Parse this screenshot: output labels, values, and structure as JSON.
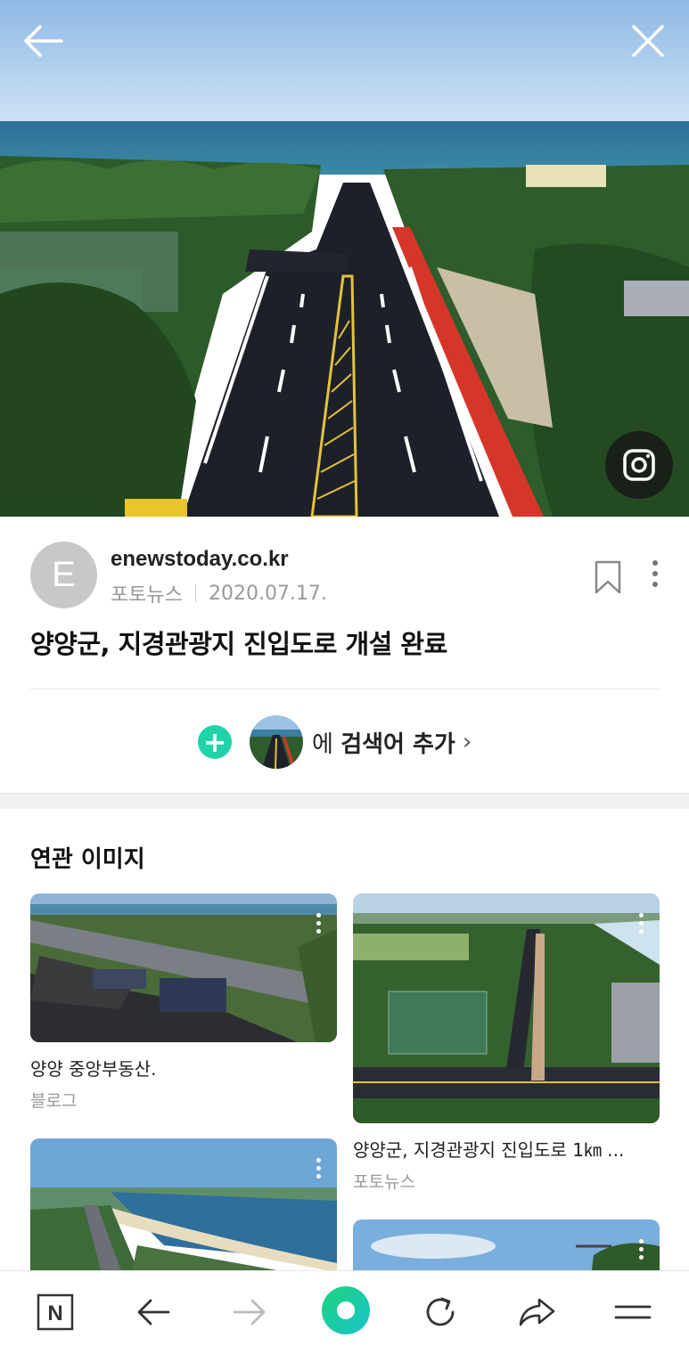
{
  "hero": {
    "back_icon": "arrow-left-icon",
    "close_icon": "close-icon",
    "lens_icon": "lens-search-icon"
  },
  "article": {
    "avatar_letter": "E",
    "source": "enewstoday.co.kr",
    "category": "포토뉴스",
    "date": "2020.07.17.",
    "title": "양양군, 지경관광지 진입도로 개설 완료",
    "add_prefix": "에 ",
    "add_bold": "검색어 추가",
    "add_chevron": "›"
  },
  "related": {
    "heading": "연관 이미지",
    "items": [
      {
        "caption": "양양 중앙부동산.",
        "source": "블로그"
      },
      {
        "caption": "양양군, 지경관광지 진입도로 1㎞ ...",
        "source": "포토뉴스"
      }
    ]
  },
  "toolbar": {
    "items": [
      "naver-home-icon",
      "back-arrow-icon",
      "forward-arrow-icon",
      "green-dot-icon",
      "refresh-icon",
      "share-icon",
      "menu-icon"
    ],
    "home_letter": "N"
  },
  "colors": {
    "accent_green": "#20d3a8",
    "road_red": "#d6362a"
  }
}
